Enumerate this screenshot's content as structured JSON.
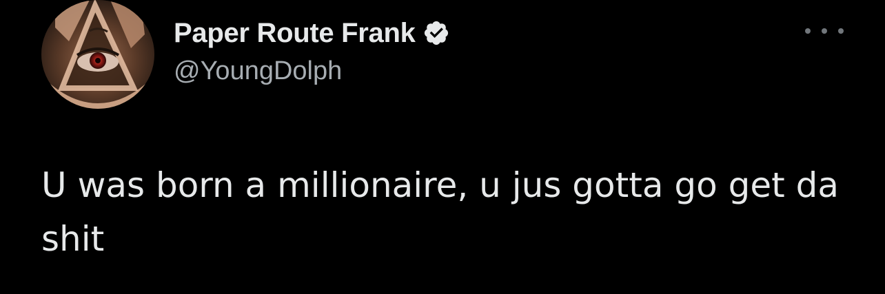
{
  "tweet": {
    "author": {
      "display_name": "Paper Route Frank",
      "handle": "@YoungDolph",
      "verified": true,
      "avatar_icon": "profile-avatar"
    },
    "text": "U was born a millionaire, u jus gotta go get da shit",
    "more_icon": "more-options-icon"
  },
  "colors": {
    "background": "#000000",
    "primary_text": "#e7e9ea",
    "secondary_text": "#a7adb2",
    "verified_badge": "#e7e9ea"
  }
}
